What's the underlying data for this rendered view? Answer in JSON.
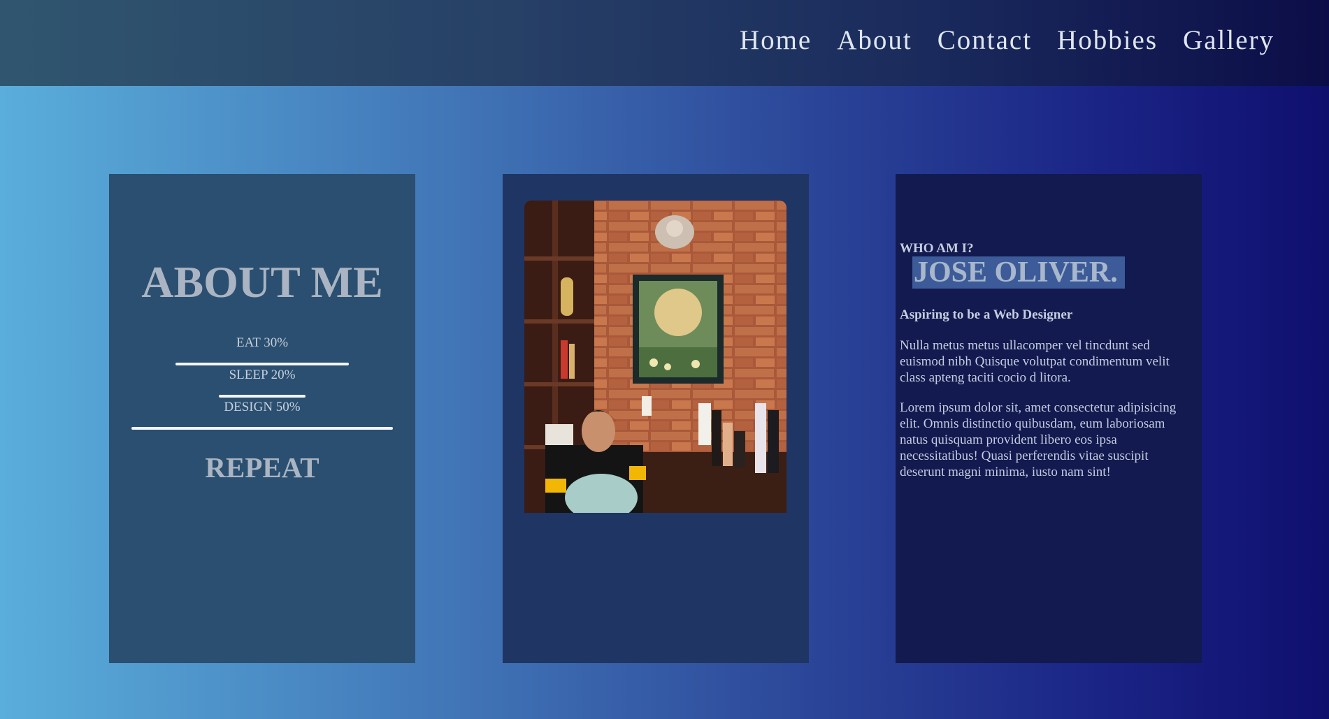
{
  "nav": {
    "items": [
      "Home",
      "About",
      "Contact",
      "Hobbies",
      "Gallery"
    ]
  },
  "about_card": {
    "title": "ABOUT ME",
    "stats": [
      {
        "label": "EAT 30%",
        "value": 30
      },
      {
        "label": "SLEEP 20%",
        "value": 20
      },
      {
        "label": "DESIGN 50%",
        "value": 50
      }
    ],
    "footer": "REPEAT"
  },
  "photo_card": {
    "alt": "Portrait photo"
  },
  "bio_card": {
    "eyebrow": "WHO AM I?",
    "name": "JOSE OLIVER.",
    "tagline": "Aspiring to be a Web Designer",
    "paragraph1": "Nulla metus metus ullacomper vel tincdunt sed euismod nibh Quisque volutpat condimentum velit class apteng taciti cocio d litora.",
    "paragraph2": "Lorem ipsum dolor sit, amet consectetur adipisicing elit. Omnis distinctio quibusdam, eum laboriosam natus quisquam provident libero eos ipsa necessitatibus! Quasi perferendis vitae suscipit deserunt magni minima, iusto nam sint!"
  },
  "colors": {
    "navbar": "#263f66",
    "card_left": "#2b4f70",
    "card_mid": "#1f3564",
    "card_right": "#121a4f",
    "name_highlight": "#3c5b98"
  }
}
